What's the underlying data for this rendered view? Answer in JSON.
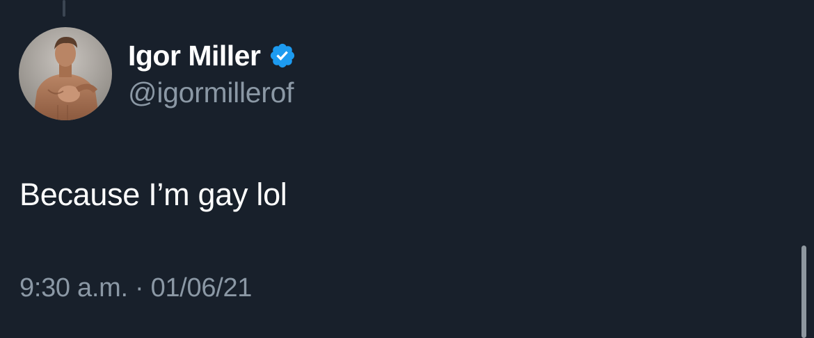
{
  "tweet": {
    "author": {
      "display_name": "Igor Miller",
      "handle": "@igormillerof",
      "verified": true,
      "verified_badge_color": "#1d9bf0",
      "avatar_icon": "profile-photo"
    },
    "text": "Because I’m gay lol",
    "time": "9:30 a.m.",
    "separator": "·",
    "date": "01/06/21"
  },
  "colors": {
    "background": "#18202b",
    "primary_text": "#ffffff",
    "secondary_text": "#8b98a5"
  }
}
